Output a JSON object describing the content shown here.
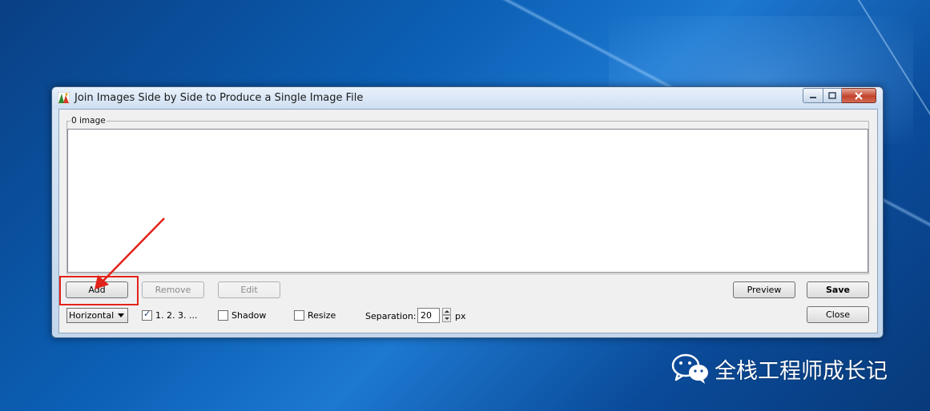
{
  "window": {
    "title": "Join Images Side by Side to Produce a Single Image File"
  },
  "list": {
    "group_label": "0 image"
  },
  "buttons": {
    "add": "Add",
    "remove": "Remove",
    "edit": "Edit",
    "preview": "Preview",
    "save": "Save",
    "close": "Close"
  },
  "options": {
    "orientation": "Horizontal",
    "numbering_label": "1. 2. 3. ...",
    "numbering_checked": true,
    "shadow_label": "Shadow",
    "shadow_checked": false,
    "resize_label": "Resize",
    "resize_checked": false,
    "separation_label": "Separation:",
    "separation_value": "20",
    "separation_unit": "px"
  },
  "watermark": {
    "text": "全栈工程师成长记"
  },
  "colors": {
    "highlight": "#e2231a",
    "annotation_arrow": "#e2231a"
  }
}
